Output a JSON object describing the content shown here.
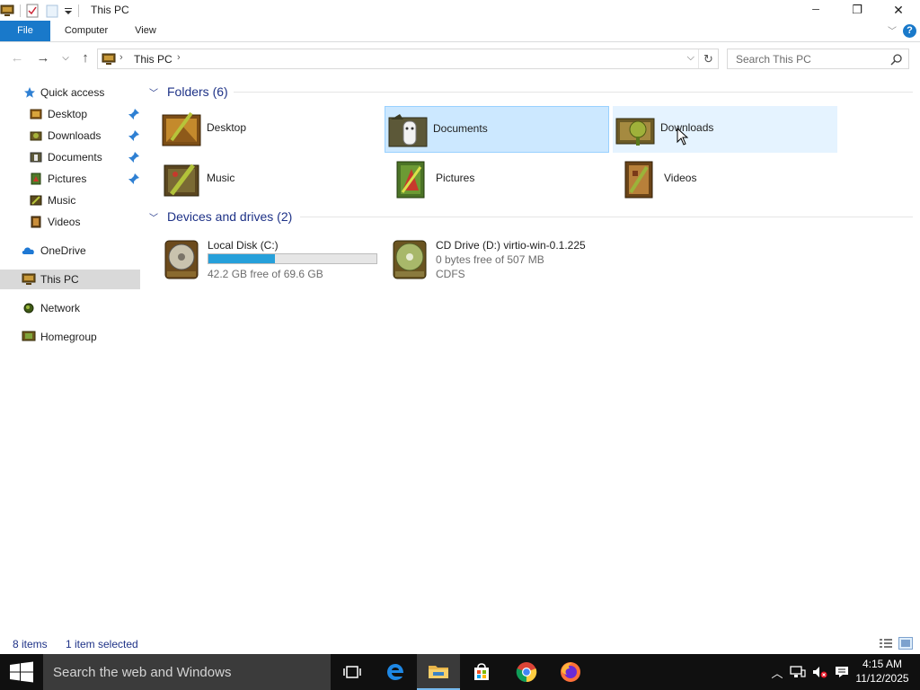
{
  "window": {
    "title": "This PC",
    "minimize_glyph": "─",
    "maximize_glyph": "❐",
    "close_glyph": "✕"
  },
  "ribbon": {
    "tabs": [
      {
        "label": "File",
        "active": true
      },
      {
        "label": "Computer"
      },
      {
        "label": "View"
      }
    ],
    "help_glyph": "?"
  },
  "address_bar": {
    "breadcrumb": "This PC",
    "search_placeholder": "Search This PC"
  },
  "nav_pane": {
    "items": [
      {
        "label": "Quick access",
        "icon": "star-icon"
      },
      {
        "label": "Desktop",
        "icon": "folder-desktop-icon",
        "pinned": true
      },
      {
        "label": "Downloads",
        "icon": "folder-downloads-icon",
        "pinned": true
      },
      {
        "label": "Documents",
        "icon": "folder-documents-icon",
        "pinned": true
      },
      {
        "label": "Pictures",
        "icon": "folder-pictures-icon",
        "pinned": true
      },
      {
        "label": "Music",
        "icon": "folder-music-icon"
      },
      {
        "label": "Videos",
        "icon": "folder-videos-icon"
      },
      {
        "label": "OneDrive",
        "icon": "cloud-icon"
      },
      {
        "label": "This PC",
        "icon": "computer-icon",
        "selected": true
      },
      {
        "label": "Network",
        "icon": "network-icon"
      },
      {
        "label": "Homegroup",
        "icon": "homegroup-icon"
      }
    ]
  },
  "content": {
    "folders_header": "Folders (6)",
    "folders": [
      {
        "name": "Desktop"
      },
      {
        "name": "Documents",
        "state": "selected"
      },
      {
        "name": "Downloads",
        "state": "hover"
      },
      {
        "name": "Music"
      },
      {
        "name": "Pictures"
      },
      {
        "name": "Videos"
      }
    ],
    "devices_header": "Devices and drives (2)",
    "drives": [
      {
        "name": "Local Disk (C:)",
        "free_text": "42.2 GB free of 69.6 GB",
        "used_fraction": 0.394
      },
      {
        "name": "CD Drive (D:) virtio-win-0.1.225",
        "free_text": "0 bytes free of 507 MB",
        "fs": "CDFS"
      }
    ]
  },
  "status_bar": {
    "item_count": "8 items",
    "selection": "1 item selected"
  },
  "taskbar": {
    "search_placeholder": "Search the web and Windows",
    "time": "4:15 AM",
    "date": "11/12/2025",
    "colors": {
      "background": "#101010",
      "search": "#3b3b3b",
      "accent": "#76b9ed"
    }
  },
  "colors": {
    "file_tab": "#1979ca",
    "selection_bg": "#cce8ff",
    "hover_bg": "#e5f3ff",
    "group_header": "#1e3287",
    "progress_fill": "#26a0da"
  }
}
